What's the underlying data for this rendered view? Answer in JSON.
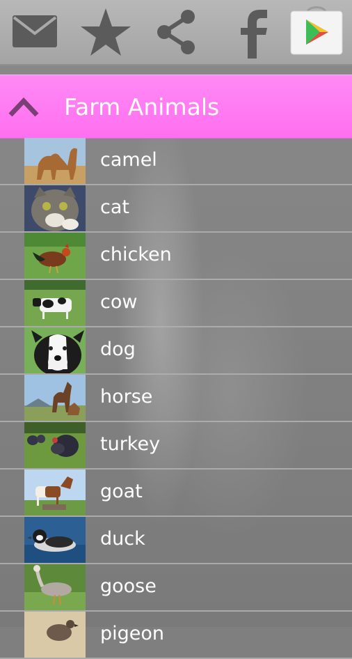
{
  "toolbar": {
    "icons": [
      "mail-icon",
      "star-icon",
      "share-icon",
      "facebook-icon",
      "play-store-icon"
    ]
  },
  "header": {
    "title": "Farm Animals",
    "icon": "chevron-up-icon",
    "color": "#ff78f2"
  },
  "animals": [
    {
      "name": "camel",
      "icon": "camel-photo"
    },
    {
      "name": "cat",
      "icon": "cat-photo"
    },
    {
      "name": "chicken",
      "icon": "chicken-photo"
    },
    {
      "name": "cow",
      "icon": "cow-photo"
    },
    {
      "name": "dog",
      "icon": "dog-photo"
    },
    {
      "name": "horse",
      "icon": "horse-photo"
    },
    {
      "name": "turkey",
      "icon": "turkey-photo"
    },
    {
      "name": "goat",
      "icon": "goat-photo"
    },
    {
      "name": "duck",
      "icon": "duck-photo"
    },
    {
      "name": "goose",
      "icon": "goose-photo"
    },
    {
      "name": "pigeon",
      "icon": "pigeon-photo"
    }
  ]
}
